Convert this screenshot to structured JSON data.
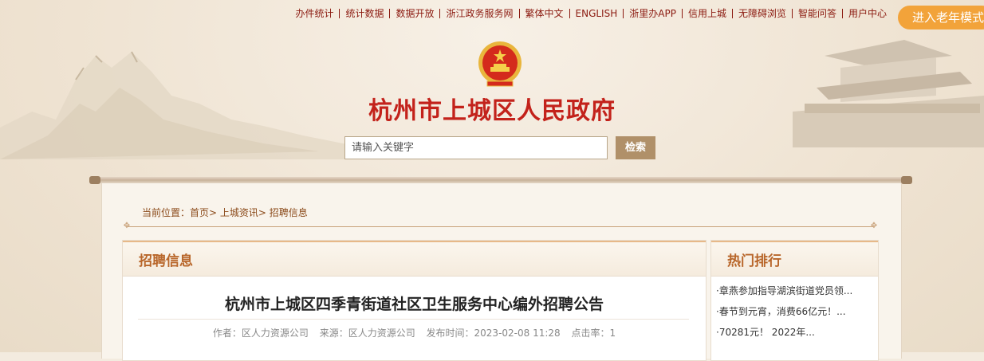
{
  "top_links": [
    "办件统计",
    "统计数据",
    "数据开放",
    "浙江政务服务网",
    "繁体中文",
    "ENGLISH",
    "浙里办APP",
    "信用上城",
    "无障碍浏览",
    "智能问答",
    "用户中心"
  ],
  "elder_mode_label": "进入老年模式",
  "site_title": "杭州市上城区人民政府",
  "search": {
    "placeholder": "请输入关键字",
    "button": "检索"
  },
  "breadcrumb": {
    "prefix": "当前位置：",
    "home": "首页",
    "sep": "> ",
    "section": "上城资讯",
    "current": "招聘信息"
  },
  "main": {
    "heading": "招聘信息",
    "article_title": "杭州市上城区四季青街道社区卫生服务中心编外招聘公告",
    "meta": {
      "author": "作者：区人力资源公司",
      "source": "来源：区人力资源公司",
      "published": "发布时间：2023-02-08 11:28",
      "clicks": "点击率：1"
    }
  },
  "sidebar": {
    "heading": "热门排行",
    "items": [
      "·章燕参加指导湖滨街道党员领...",
      "·春节到元宵，消费66亿元！...",
      "·70281元！ 2022年..."
    ]
  },
  "colors": {
    "title_red": "#c3221b",
    "link_red": "#8b1a10",
    "accent_brown": "#b8662a",
    "button_tan": "#b09069",
    "elder_orange": "#f2a33a"
  }
}
